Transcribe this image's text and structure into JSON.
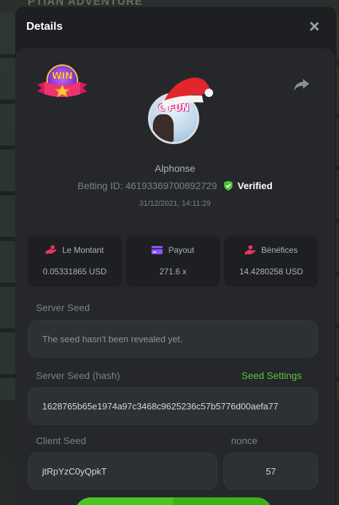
{
  "background": {
    "game_title": "PTIAN ADVENTURE"
  },
  "modal": {
    "title": "Details",
    "close_icon": "close-icon"
  },
  "card": {
    "badge_text": "WIN",
    "avatar_text": "C FUN",
    "user_name": "Alphonse",
    "betting_id_label": "Betting ID:",
    "betting_id_value": "46193369700892729",
    "verified_label": "Verified",
    "timestamp": "31/12/2021, 14:11:29",
    "share_icon": "share-icon"
  },
  "stats": [
    {
      "label": "Le Montant",
      "value": "0.05331865 USD",
      "icon": "money-hand-icon",
      "color": "#e8365d"
    },
    {
      "label": "Payout",
      "value": "271.6 x",
      "icon": "card-icon",
      "color": "#8a55ff"
    },
    {
      "label": "Bénéfices",
      "value": "14.4280258 USD",
      "icon": "profit-hand-icon",
      "color": "#e8365d"
    }
  ],
  "server_seed": {
    "label": "Server Seed",
    "value": "The seed hasn't been revealed yet."
  },
  "server_seed_hash": {
    "label": "Server Seed (hash)",
    "settings_link": "Seed Settings",
    "value": "1628765b65e1974a97c3468c9625236c57b5776d00aefa77"
  },
  "client_seed": {
    "label": "Client Seed",
    "value": "jtRpYzC0yQpkT"
  },
  "nonce": {
    "label": "nonce",
    "value": "57"
  },
  "colors": {
    "accent_green": "#5cc43b",
    "button_green": "#47c61f",
    "panel": "#25272b"
  }
}
